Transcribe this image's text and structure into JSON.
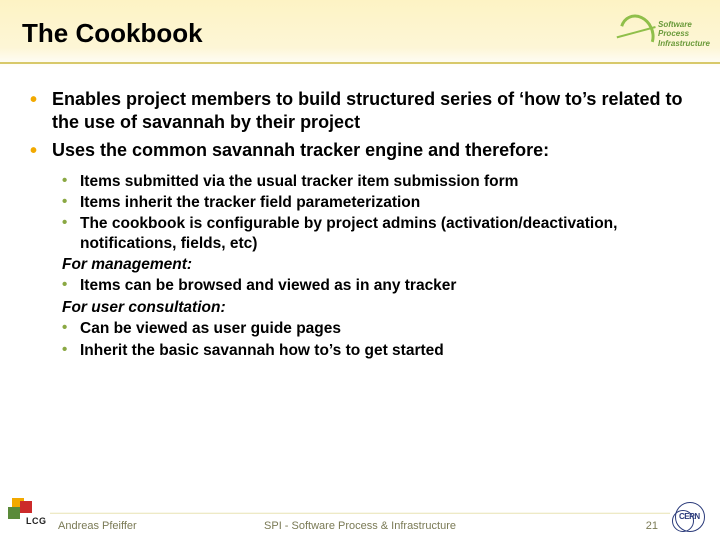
{
  "header": {
    "title": "The Cookbook",
    "spi_logo_lines": [
      "Software",
      "Process",
      "Infrastructure"
    ]
  },
  "bullets": {
    "b1": "Enables project members to build structured series of ‘how to’s related to the use of savannah by their project",
    "b2": "Uses the common savannah tracker engine and therefore:",
    "sub": {
      "s1": "Items submitted via the usual tracker item submission form",
      "s2": "Items inherit the tracker field parameterization",
      "s3": "The cookbook is configurable by project admins (activation/deactivation, notifications, fields, etc)",
      "label1": "For management:",
      "s4": "Items can be browsed and viewed as in any tracker",
      "label2": "For user consultation:",
      "s5": "Can be viewed as user guide pages",
      "s6": "Inherit the basic savannah how to’s to get started"
    }
  },
  "footer": {
    "lcg_label": "LCG",
    "author": "Andreas Pfeiffer",
    "center": "SPI - Software Process & Infrastructure",
    "page": "21",
    "cern_label": "CERN"
  }
}
